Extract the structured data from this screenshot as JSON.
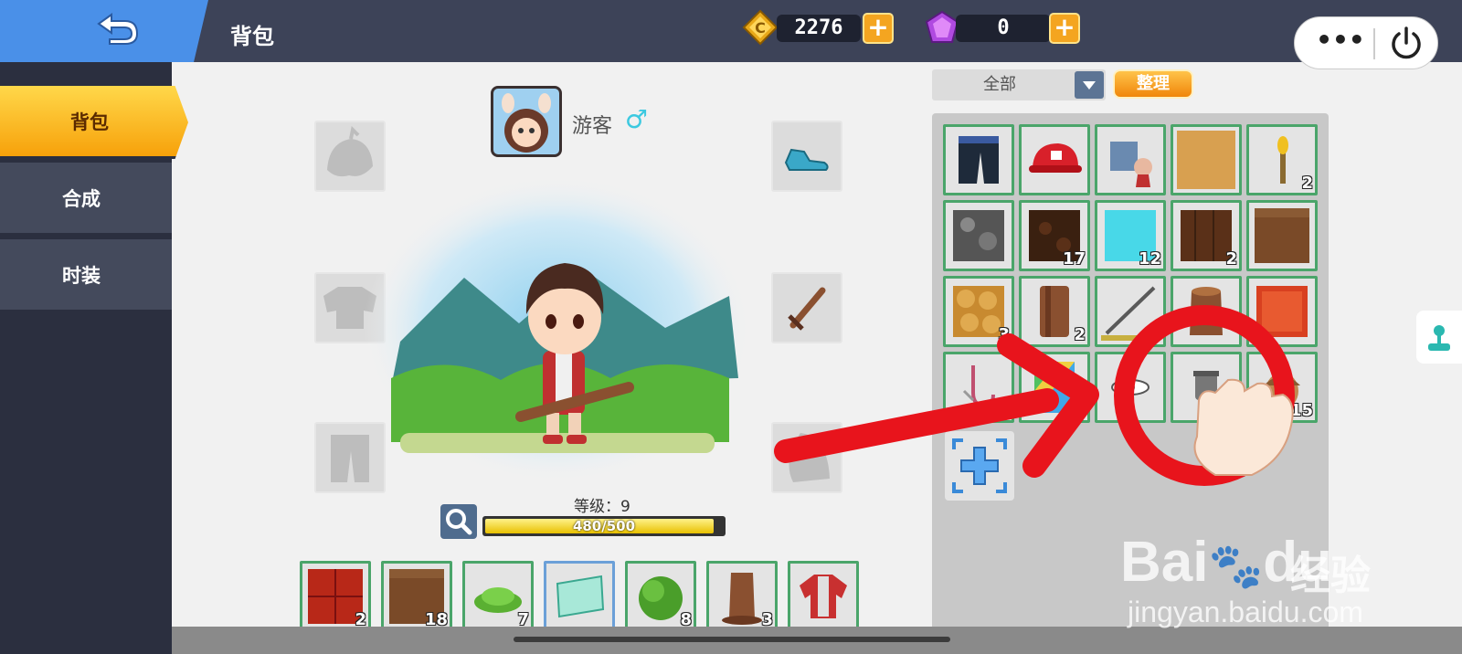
{
  "header": {
    "title": "背包",
    "back_icon": "back-arrow-icon",
    "coins": "2276",
    "gems": "0",
    "more_label": "•••",
    "power_icon": "power-icon"
  },
  "sidebar": {
    "items": [
      {
        "label": "背包",
        "active": true
      },
      {
        "label": "合成",
        "active": false
      },
      {
        "label": "时装",
        "active": false
      }
    ]
  },
  "character": {
    "name": "游客",
    "gender_symbol": "♂",
    "level_label": "等级：9",
    "xp_text": "480/500",
    "xp_fraction": 0.96
  },
  "equipment": {
    "slots": [
      "hat-slot-icon",
      "torso-slot-icon",
      "pants-slot-icon",
      "shoes-icon",
      "sword-icon",
      "cape-slot-icon"
    ]
  },
  "hotbar": [
    {
      "icon": "red-block-icon",
      "qty": "2"
    },
    {
      "icon": "dirt-block-icon",
      "qty": "18"
    },
    {
      "icon": "grass-tuft-icon",
      "qty": "7"
    },
    {
      "icon": "map-icon",
      "qty": ""
    },
    {
      "icon": "bush-icon",
      "qty": "8"
    },
    {
      "icon": "tree-stump-icon",
      "qty": "3"
    },
    {
      "icon": "red-jacket-icon",
      "qty": ""
    }
  ],
  "inventory": {
    "filter_label": "全部",
    "sort_label": "整理",
    "items": [
      {
        "icon": "pants-icon",
        "qty": ""
      },
      {
        "icon": "red-cap-icon",
        "qty": ""
      },
      {
        "icon": "armor-icon",
        "qty": ""
      },
      {
        "icon": "sand-block-icon",
        "qty": ""
      },
      {
        "icon": "torch-icon",
        "qty": "2"
      },
      {
        "icon": "stone-block-icon",
        "qty": ""
      },
      {
        "icon": "dark-soil-block-icon",
        "qty": "17"
      },
      {
        "icon": "water-block-icon",
        "qty": "12"
      },
      {
        "icon": "wood-plank-icon",
        "qty": "2"
      },
      {
        "icon": "dirt-block-icon",
        "qty": ""
      },
      {
        "icon": "cobblestone-icon",
        "qty": "3"
      },
      {
        "icon": "log-icon",
        "qty": "2"
      },
      {
        "icon": "fishing-rod-icon",
        "qty": ""
      },
      {
        "icon": "stump-icon",
        "qty": ""
      },
      {
        "icon": "red-brick-icon",
        "qty": ""
      },
      {
        "icon": "hook-icon",
        "qty": ""
      },
      {
        "icon": "rainbow-block-icon",
        "qty": ""
      },
      {
        "icon": "eye-icon",
        "qty": ""
      },
      {
        "icon": "pot-icon",
        "qty": ""
      },
      {
        "icon": "acorn-icon",
        "qty": "15"
      }
    ]
  },
  "colors": {
    "accent_orange": "#f7a10a",
    "topbar": "#3d4358",
    "slot_border": "#4aa56a",
    "annotation_red": "#e8141c"
  },
  "watermark": {
    "main": "Bai",
    "suffix": "du",
    "cn": "经验",
    "url": "jingyan.baidu.com"
  }
}
